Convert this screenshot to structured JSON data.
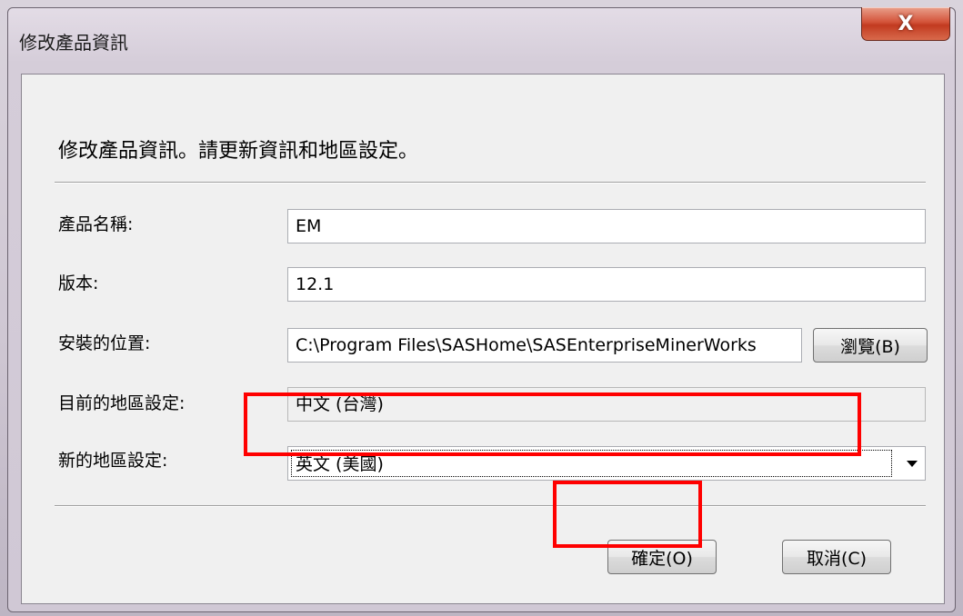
{
  "window": {
    "title": "修改產品資訊",
    "close_label": "X"
  },
  "heading": "修改產品資訊。請更新資訊和地區設定。",
  "form": {
    "product_name": {
      "label": "產品名稱:",
      "value": "EM"
    },
    "version": {
      "label": "版本:",
      "value": "12.1"
    },
    "install_location": {
      "label": "安裝的位置:",
      "value": "C:\\Program Files\\SASHome\\SASEnterpriseMinerWorks",
      "browse_label": "瀏覽(B)"
    },
    "current_locale": {
      "label": "目前的地區設定:",
      "value": "中文 (台灣)"
    },
    "new_locale": {
      "label": "新的地區設定:",
      "selected": "英文 (美國)"
    }
  },
  "buttons": {
    "ok_label": "確定(O)",
    "cancel_label": "取消(C)"
  },
  "colors": {
    "annotation": "#ff0000",
    "close_button": "#c8452b"
  }
}
